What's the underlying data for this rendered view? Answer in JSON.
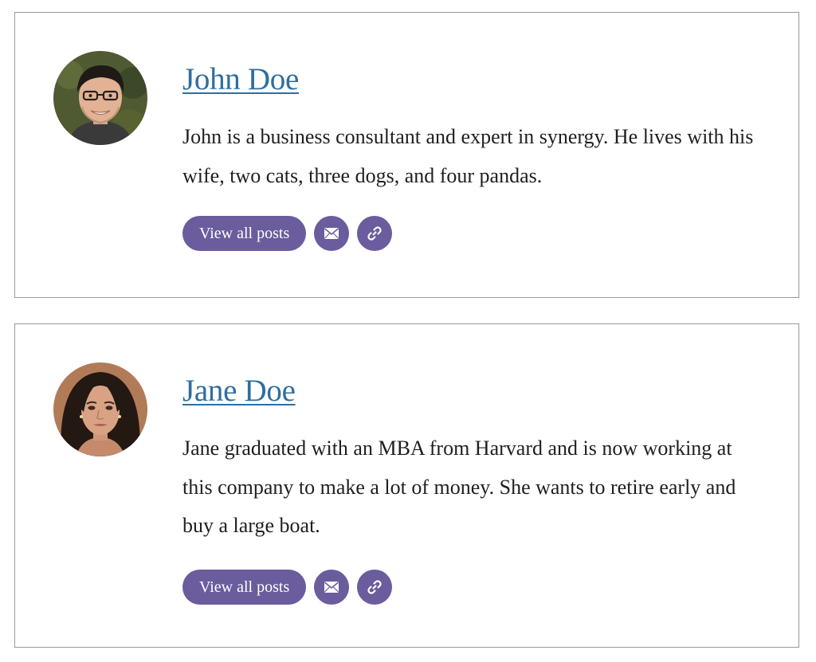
{
  "authors": [
    {
      "name": "John Doe",
      "bio": "John is a business consultant and expert in synergy. He lives with his wife, two cats, three dogs, and four pandas.",
      "view_posts_label": "View all posts",
      "email_icon": "email-icon",
      "link_icon": "link-icon",
      "avatar_icon": "man-avatar"
    },
    {
      "name": "Jane Doe",
      "bio": "Jane graduated with an MBA from Harvard and is now working at this company to make a lot of money. She wants to retire early and buy a large boat.",
      "view_posts_label": "View all posts",
      "email_icon": "email-icon",
      "link_icon": "link-icon",
      "avatar_icon": "woman-avatar"
    }
  ],
  "colors": {
    "link": "#2f6e9e",
    "button": "#6a5c9d",
    "border": "#9a9a9a"
  }
}
